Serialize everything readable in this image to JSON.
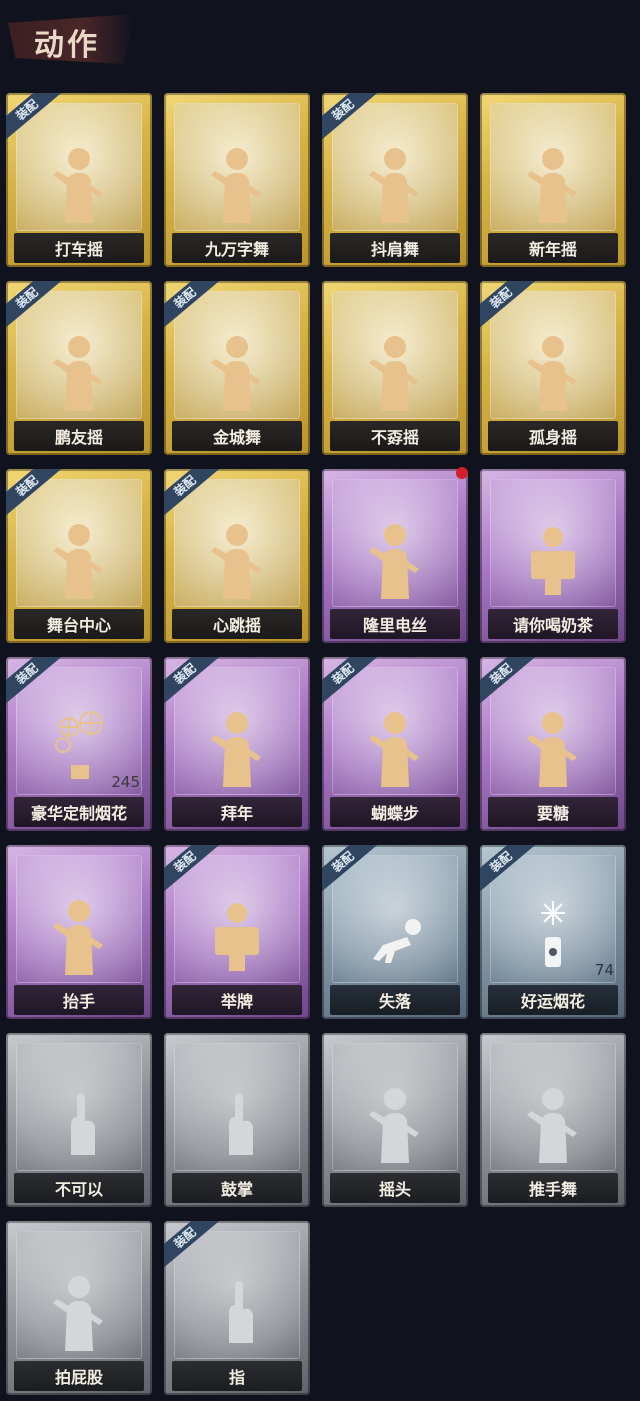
{
  "header": {
    "title": "动作"
  },
  "equip_label": "装配",
  "cards": [
    {
      "name": "打车摇",
      "rarity": "gold",
      "equipped": true,
      "icon": "dance-figure-icon"
    },
    {
      "name": "九万字舞",
      "rarity": "gold",
      "equipped": false,
      "icon": "dance-figure-icon"
    },
    {
      "name": "抖肩舞",
      "rarity": "gold",
      "equipped": true,
      "icon": "dance-figure-icon"
    },
    {
      "name": "新年摇",
      "rarity": "gold",
      "equipped": false,
      "icon": "dance-figure-icon"
    },
    {
      "name": "鹏友摇",
      "rarity": "gold",
      "equipped": true,
      "icon": "dance-figure-icon"
    },
    {
      "name": "金城舞",
      "rarity": "gold",
      "equipped": true,
      "icon": "dance-figure-icon"
    },
    {
      "name": "不孬摇",
      "rarity": "gold",
      "equipped": false,
      "icon": "dance-figure-icon"
    },
    {
      "name": "孤身摇",
      "rarity": "gold",
      "equipped": true,
      "icon": "dance-figure-icon"
    },
    {
      "name": "舞台中心",
      "rarity": "gold",
      "equipped": true,
      "icon": "dance-figure-icon"
    },
    {
      "name": "心跳摇",
      "rarity": "gold",
      "equipped": true,
      "icon": "dance-figure-icon"
    },
    {
      "name": "隆里电丝",
      "rarity": "purple",
      "equipped": false,
      "icon": "dance-figure-icon",
      "new": true
    },
    {
      "name": "请你喝奶茶",
      "rarity": "purple",
      "equipped": false,
      "icon": "sign-figure-icon"
    },
    {
      "name": "豪华定制烟花",
      "rarity": "purple",
      "equipped": true,
      "icon": "fireworks-icon",
      "count": "245"
    },
    {
      "name": "拜年",
      "rarity": "purple",
      "equipped": true,
      "icon": "bow-figure-icon"
    },
    {
      "name": "蝴蝶步",
      "rarity": "purple",
      "equipped": true,
      "icon": "dance-figure-icon"
    },
    {
      "name": "要糖",
      "rarity": "purple",
      "equipped": true,
      "icon": "reach-figure-icon"
    },
    {
      "name": "抬手",
      "rarity": "purple",
      "equipped": false,
      "icon": "wave-figure-icon"
    },
    {
      "name": "举牌",
      "rarity": "purple",
      "equipped": true,
      "icon": "sign-figure-icon"
    },
    {
      "name": "失落",
      "rarity": "blue",
      "equipped": true,
      "icon": "crawl-figure-icon"
    },
    {
      "name": "好运烟花",
      "rarity": "blue",
      "equipped": true,
      "icon": "firecracker-icon",
      "count": "74"
    },
    {
      "name": "不可以",
      "rarity": "grey",
      "equipped": false,
      "icon": "finger-wag-icon"
    },
    {
      "name": "鼓掌",
      "rarity": "grey",
      "equipped": false,
      "icon": "clap-icon"
    },
    {
      "name": "摇头",
      "rarity": "grey",
      "equipped": false,
      "icon": "dance-figure-icon"
    },
    {
      "name": "推手舞",
      "rarity": "grey",
      "equipped": false,
      "icon": "dance-figure-icon"
    },
    {
      "name": "拍屁股",
      "rarity": "grey",
      "equipped": false,
      "icon": "dance-figure-icon"
    },
    {
      "name": "指",
      "rarity": "grey",
      "equipped": true,
      "icon": "point-hand-icon"
    }
  ]
}
